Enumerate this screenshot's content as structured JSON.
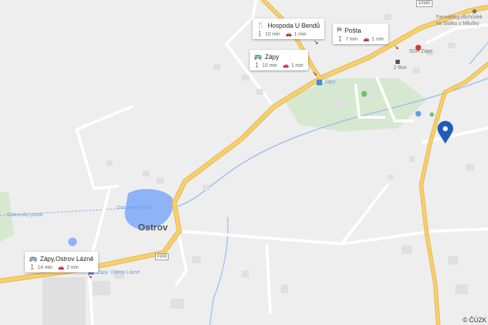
{
  "colors": {
    "background": "#eeeeee",
    "road_major": "#f6cf6e",
    "road_minor": "#ffffff",
    "water": "#8fb3f7",
    "park": "#d6e8d0",
    "pin": "#1e5db8",
    "arrow": "#d0373b"
  },
  "towns": [
    {
      "name": "Ostrov"
    }
  ],
  "water_labels": {
    "pond": "Ostrovský potok",
    "stream": "Ostrovský potok"
  },
  "place_labels": {
    "shop": "Farmářský obchůdek\nna Statku u Milušky",
    "fire": "SDH Zápy",
    "zbox": "Z-Box",
    "stop_zapy": "Zápy",
    "stop_ostrov": "Zápy, Ostrov Lázně",
    "road_small": "10160",
    "road_0103": "0103"
  },
  "cards": [
    {
      "title": "Hospoda U Bendů",
      "icon": "restaurant-icon",
      "walk": "10 min",
      "drive": "1 min"
    },
    {
      "title": "Pošta",
      "icon": "post-icon",
      "walk": "7 min",
      "drive": "1 min"
    },
    {
      "title": "Zápy",
      "icon": "bus-icon",
      "walk": "10 min",
      "drive": "1 min"
    },
    {
      "title": "Zápy,Ostrov Lázně",
      "icon": "bus-icon",
      "walk": "14 min",
      "drive": "2 min"
    }
  ],
  "copyright": "© ČÚZK"
}
